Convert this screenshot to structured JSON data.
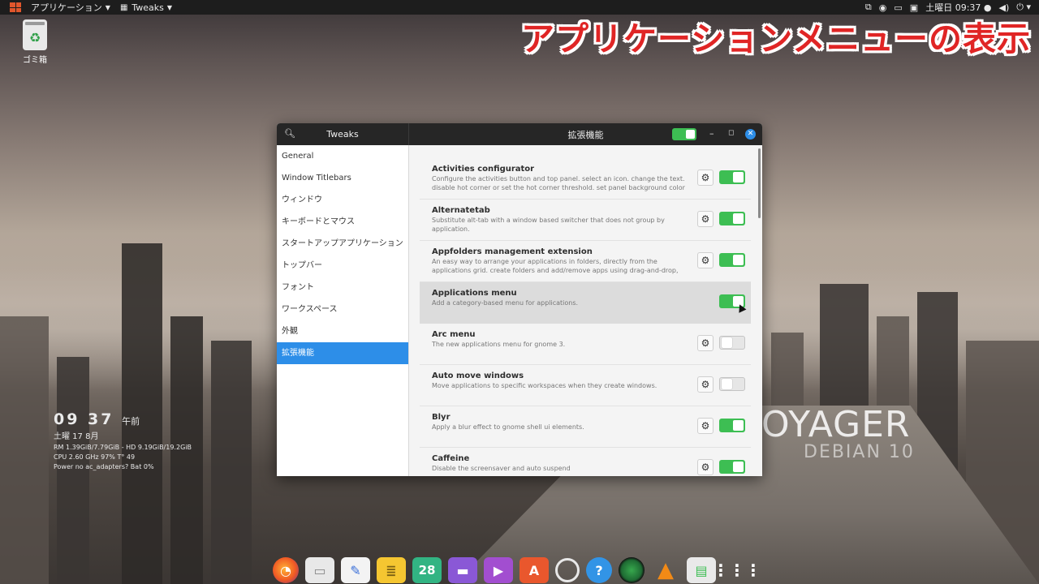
{
  "topbar": {
    "apps_menu": "アプリケーション",
    "window_menu": "Tweaks",
    "clock": "土曜日 09:37 ●"
  },
  "headline": "アプリケーションメニューの表示",
  "desktop": {
    "trash_label": "ゴミ箱",
    "conky": {
      "time": "09 37",
      "ampm": "午前",
      "date": "土曜 17 8月",
      "mem": "RM 1.39GiB/7.79GiB - HD 9.19GiB/19.2GiB",
      "cpu": "CPU 2.60 GHz 97% T° 49",
      "power": "Power no ac_adapters? Bat 0%"
    },
    "brand": "OYAGER",
    "brand_sub": "DEBIAN 10"
  },
  "window": {
    "sidebar_title": "Tweaks",
    "main_title": "拡張機能",
    "sidebar": [
      {
        "label": "General"
      },
      {
        "label": "Window Titlebars"
      },
      {
        "label": "ウィンドウ"
      },
      {
        "label": "キーボードとマウス"
      },
      {
        "label": "スタートアップアプリケーション"
      },
      {
        "label": "トップバー"
      },
      {
        "label": "フォント"
      },
      {
        "label": "ワークスペース"
      },
      {
        "label": "外観"
      },
      {
        "label": "拡張機能"
      }
    ],
    "extensions": [
      {
        "name": "Activities configurator",
        "desc": "Configure the activities button and top panel. select an icon. change the text. disable hot corner or set the hot corner threshold. set panel background color and transpare…",
        "enabled": true
      },
      {
        "name": "Alternatetab",
        "desc": "Substitute alt-tab with a window based switcher that does not group by application.",
        "enabled": true
      },
      {
        "name": "Appfolders management extension",
        "desc": "An easy way to arrange your applications in folders, directly from the applications grid. create folders and add/remove apps using drag-and-drop, rename/delete them …",
        "enabled": true
      },
      {
        "name": "Applications menu",
        "desc": "Add a category-based menu for applications.",
        "enabled": true
      },
      {
        "name": "Arc menu",
        "desc": "The new applications menu for gnome 3.",
        "enabled": false
      },
      {
        "name": "Auto move windows",
        "desc": "Move applications to specific workspaces when they create windows.",
        "enabled": false
      },
      {
        "name": "Blyr",
        "desc": "Apply a blur effect to gnome shell ui elements.",
        "enabled": true
      },
      {
        "name": "Caffeine",
        "desc": "Disable the screensaver and auto suspend",
        "enabled": true
      }
    ]
  },
  "dock": {
    "calendar_day": "28",
    "help_glyph": "?",
    "apps_glyph": "⋮⋮⋮"
  },
  "colors": {
    "accent": "#2d8ee8",
    "toggle_on": "#3dbe53",
    "headline": "#e02525"
  }
}
